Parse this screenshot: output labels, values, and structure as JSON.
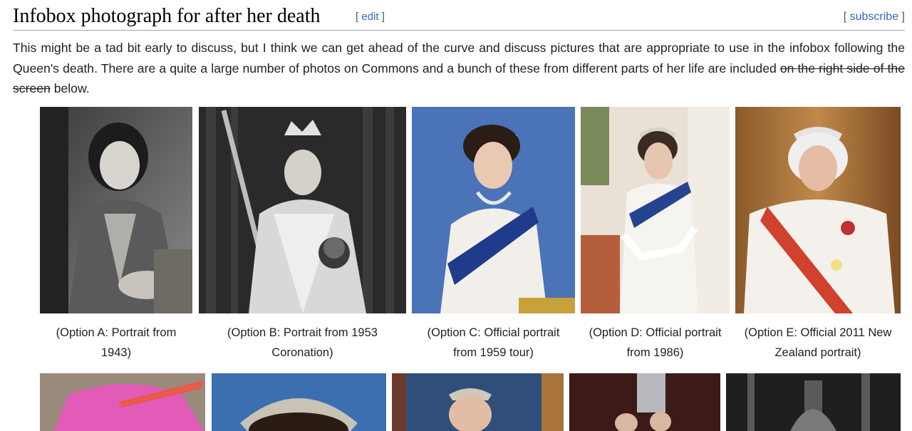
{
  "section": {
    "title": "Infobox photograph for after her death",
    "edit_label": "edit",
    "subscribe_label": "subscribe"
  },
  "paragraph": {
    "text_before": "This might be a tad bit early to discuss, but I think we can get ahead of the curve and discuss pictures that are appropriate to use in the infobox following the Queen's death. There are a quite a large number of photos on Commons and a bunch of these from different parts of her life are included ",
    "struck": "on the right side of the screen",
    "text_after": " below."
  },
  "gallery": {
    "row1": [
      {
        "caption_line1": "(Option A: Portrait from",
        "caption_line2": "1943)"
      },
      {
        "caption_line1": "(Option B: Portrait from 1953",
        "caption_line2": "Coronation)"
      },
      {
        "caption_line1": "(Option C: Official portrait",
        "caption_line2": "from 1959 tour)"
      },
      {
        "caption_line1": "(Option D: Official portrait",
        "caption_line2": "from 1986)"
      },
      {
        "caption_line1": "(Option E: Official 2011 New",
        "caption_line2": "Zealand portrait)"
      }
    ]
  },
  "colors": {
    "link": "#3366cc",
    "divider": "#a2a9b1"
  }
}
